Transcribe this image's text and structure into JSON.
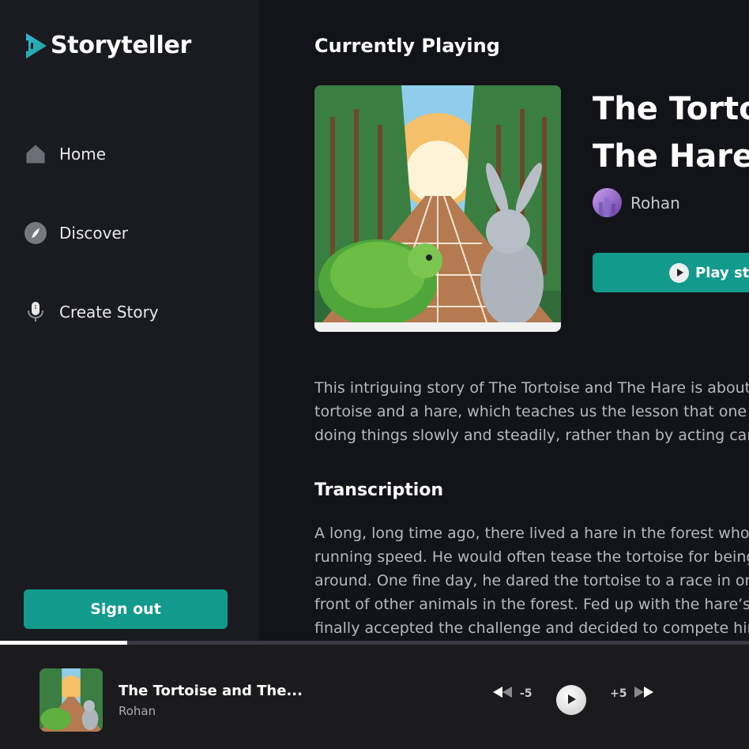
{
  "app": {
    "name": "Storyteller",
    "accent_color": "#129a8d"
  },
  "sidebar": {
    "items": [
      {
        "label": "Home",
        "icon": "home-icon"
      },
      {
        "label": "Discover",
        "icon": "compass-icon"
      },
      {
        "label": "Create Story",
        "icon": "microphone-icon"
      }
    ],
    "signout_label": "Sign out"
  },
  "main": {
    "section_title": "Currently Playing",
    "story_title": "The Tortoise and The Hare",
    "author": "Rohan",
    "play_label": "Play story",
    "description_lines": [
      "This intriguing story of The Tortoise and The Hare is about a",
      "tortoise and a hare, which teaches us the lesson that one can win by",
      "doing things slowly and steadily, rather than by acting carelessly."
    ],
    "transcription_title": "Transcription",
    "transcript_lines": [
      "A long, long time ago, there lived a hare in the forest who always",
      "running speed. He would often tease the tortoise for being so slow",
      "around. One fine day, he dared the tortoise to a race in order to",
      "front of other animals in the forest. Fed up with the hare’s boasting",
      "finally accepted the challenge and decided to compete him."
    ]
  },
  "player": {
    "title": "The Tortoise and The...",
    "author": "Rohan",
    "rewind_label": "-5",
    "forward_label": "+5",
    "progress": 0.17
  }
}
